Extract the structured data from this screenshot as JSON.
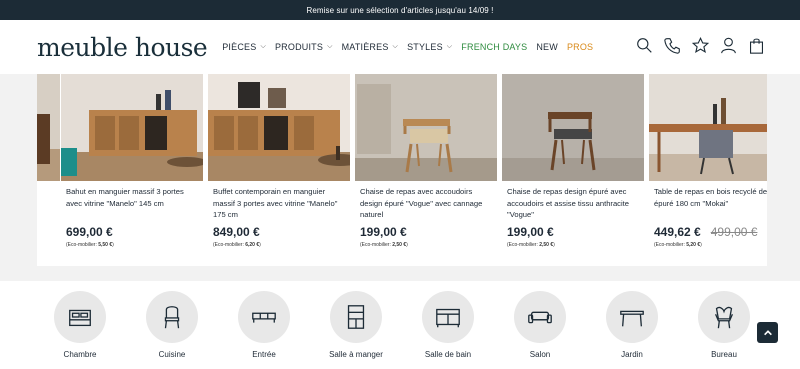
{
  "promo": {
    "text": "Remise sur une sélection d'articles jusqu'au 14/09 !"
  },
  "header": {
    "logo": "meuble house",
    "nav": [
      {
        "label": "PIÈCES",
        "dropdown": true,
        "color": "#1f2a36"
      },
      {
        "label": "PRODUITS",
        "dropdown": true,
        "color": "#1f2a36"
      },
      {
        "label": "MATIÈRES",
        "dropdown": true,
        "color": "#1f2a36"
      },
      {
        "label": "STYLES",
        "dropdown": true,
        "color": "#1f2a36"
      },
      {
        "label": "FRENCH DAYS",
        "dropdown": false,
        "color": "#2e8b3e"
      },
      {
        "label": "NEW",
        "dropdown": false,
        "color": "#1f2a36"
      },
      {
        "label": "PROS",
        "dropdown": false,
        "color": "#d98a1a"
      }
    ],
    "icons": [
      "search-icon",
      "phone-icon",
      "star-icon",
      "user-icon",
      "bag-icon"
    ]
  },
  "products": [
    {
      "title": "Bahut en manguier massif 3 portes avec vitrine \"Manelo\" 145 cm",
      "price": "699,00 €",
      "old_price": "",
      "eco_label": "(Eco-mobilier: ",
      "eco_value": "5,50 €",
      "eco_end": ")"
    },
    {
      "title": "Buffet contemporain en manguier massif 3 portes avec vitrine \"Manelo\" 175 cm",
      "price": "849,00 €",
      "old_price": "",
      "eco_label": "(Eco-mobilier: ",
      "eco_value": "6,20 €",
      "eco_end": ")"
    },
    {
      "title": "Chaise de repas avec accoudoirs design épuré \"Vogue\" avec cannage naturel",
      "price": "199,00 €",
      "old_price": "",
      "eco_label": "(Eco-mobilier: ",
      "eco_value": "2,50 €",
      "eco_end": ")"
    },
    {
      "title": "Chaise de repas design épuré avec accoudoirs et assise tissu anthracite \"Vogue\"",
      "price": "199,00 €",
      "old_price": "",
      "eco_label": "(Eco-mobilier: ",
      "eco_value": "2,50 €",
      "eco_end": ")"
    },
    {
      "title": "Table de repas en bois recyclé design épuré 180 cm \"Mokai\"",
      "price": "449,62 €",
      "old_price": "499,00 €",
      "eco_label": "(Eco-mobilier: ",
      "eco_value": "5,20 €",
      "eco_end": ")"
    }
  ],
  "categories": [
    {
      "label": "Chambre",
      "icon": "bed-icon"
    },
    {
      "label": "Cuisine",
      "icon": "chair-icon"
    },
    {
      "label": "Entrée",
      "icon": "console-icon"
    },
    {
      "label": "Salle à manger",
      "icon": "cabinet-icon"
    },
    {
      "label": "Salle de bain",
      "icon": "vanity-icon"
    },
    {
      "label": "Salon",
      "icon": "sofa-icon"
    },
    {
      "label": "Jardin",
      "icon": "table-icon"
    },
    {
      "label": "Bureau",
      "icon": "armchair-icon"
    }
  ]
}
